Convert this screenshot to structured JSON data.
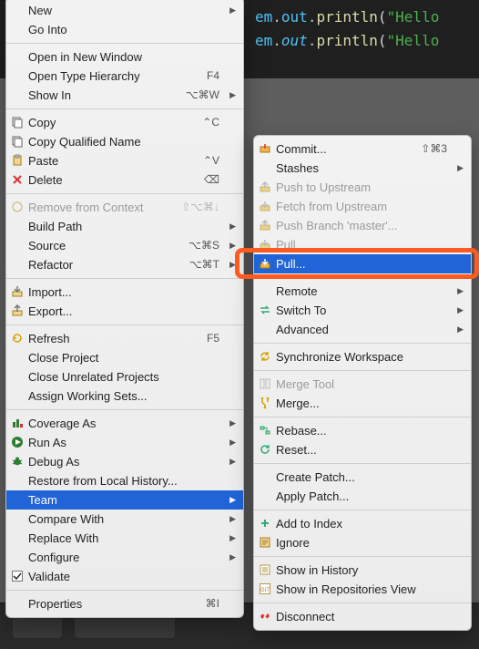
{
  "editor": {
    "dot": ".",
    "lp": "(",
    "line1": {
      "a": "em",
      "b": "out",
      "c": "println",
      "d": "\"Hello"
    },
    "line2": {
      "a": "em",
      "b": "out",
      "c": "println",
      "d": "\"Hello"
    }
  },
  "main": {
    "items": [
      {
        "label": "New"
      },
      {
        "label": "Go Into"
      },
      {
        "label": "Open in New Window"
      },
      {
        "label": "Open Type Hierarchy",
        "shortcut": "F4"
      },
      {
        "label": "Show In",
        "shortcut": "⌥⌘W"
      },
      {
        "label": "Copy",
        "shortcut": "⌃C"
      },
      {
        "label": "Copy Qualified Name"
      },
      {
        "label": "Paste",
        "shortcut": "⌃V"
      },
      {
        "label": "Delete",
        "shortcut": "⌫"
      },
      {
        "label": "Remove from Context",
        "shortcut": "⇧⌥⌘↓"
      },
      {
        "label": "Build Path"
      },
      {
        "label": "Source",
        "shortcut": "⌥⌘S"
      },
      {
        "label": "Refactor",
        "shortcut": "⌥⌘T"
      },
      {
        "label": "Import..."
      },
      {
        "label": "Export..."
      },
      {
        "label": "Refresh",
        "shortcut": "F5"
      },
      {
        "label": "Close Project"
      },
      {
        "label": "Close Unrelated Projects"
      },
      {
        "label": "Assign Working Sets..."
      },
      {
        "label": "Coverage As"
      },
      {
        "label": "Run As"
      },
      {
        "label": "Debug As"
      },
      {
        "label": "Restore from Local History..."
      },
      {
        "label": "Team"
      },
      {
        "label": "Compare With"
      },
      {
        "label": "Replace With"
      },
      {
        "label": "Configure"
      },
      {
        "label": "Validate"
      },
      {
        "label": "Properties",
        "shortcut": "⌘I"
      }
    ]
  },
  "team": {
    "items": [
      {
        "label": "Commit...",
        "shortcut": "⇧⌘3"
      },
      {
        "label": "Stashes"
      },
      {
        "label": "Push to Upstream"
      },
      {
        "label": "Fetch from Upstream"
      },
      {
        "label": "Push Branch 'master'..."
      },
      {
        "label": "Pull"
      },
      {
        "label": "Pull..."
      },
      {
        "label": "Remote"
      },
      {
        "label": "Switch To"
      },
      {
        "label": "Advanced"
      },
      {
        "label": "Synchronize Workspace"
      },
      {
        "label": "Merge Tool"
      },
      {
        "label": "Merge..."
      },
      {
        "label": "Rebase..."
      },
      {
        "label": "Reset..."
      },
      {
        "label": "Create Patch..."
      },
      {
        "label": "Apply Patch..."
      },
      {
        "label": "Add to Index"
      },
      {
        "label": "Ignore"
      },
      {
        "label": "Show in History"
      },
      {
        "label": "Show in Repositories View"
      },
      {
        "label": "Disconnect"
      }
    ]
  }
}
